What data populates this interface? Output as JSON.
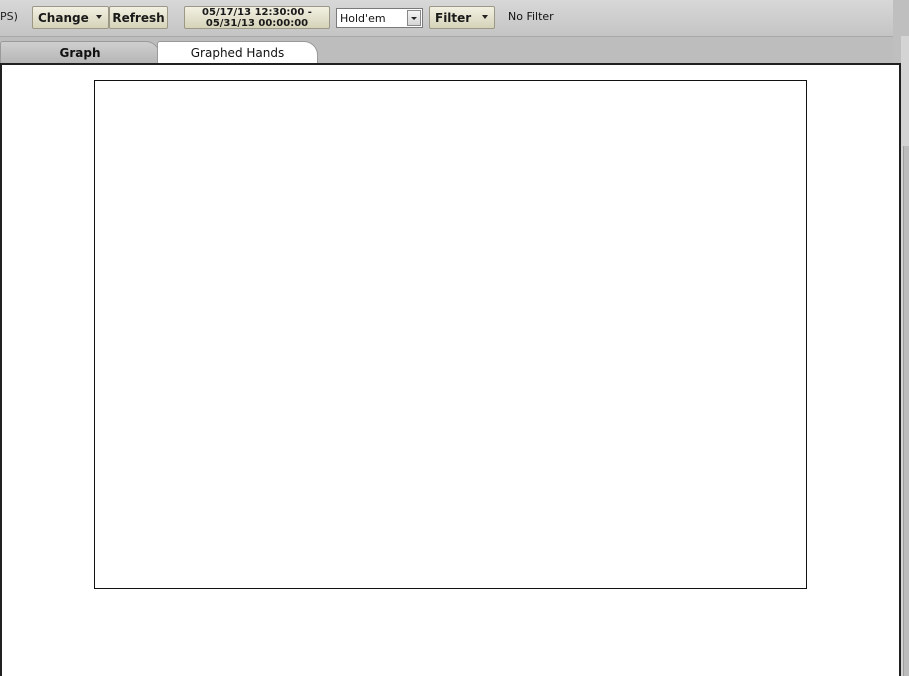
{
  "toolbar": {
    "site_suffix": "PS)",
    "change_label": "Change",
    "refresh_label": "Refresh",
    "date_range_line1": "05/17/13 12:30:00 -",
    "date_range_line2": "05/31/13 00:00:00",
    "game_select_value": "Hold'em",
    "filter_label": "Filter",
    "filter_status": "No Filter"
  },
  "tabs": [
    {
      "label": "Graph",
      "active": true
    },
    {
      "label": "Graphed Hands",
      "active": false
    }
  ],
  "colors": {
    "toolbar_bg": "#c8c8c8",
    "button_bg": "#e4e1cc",
    "content_bg": "#ffffff"
  }
}
